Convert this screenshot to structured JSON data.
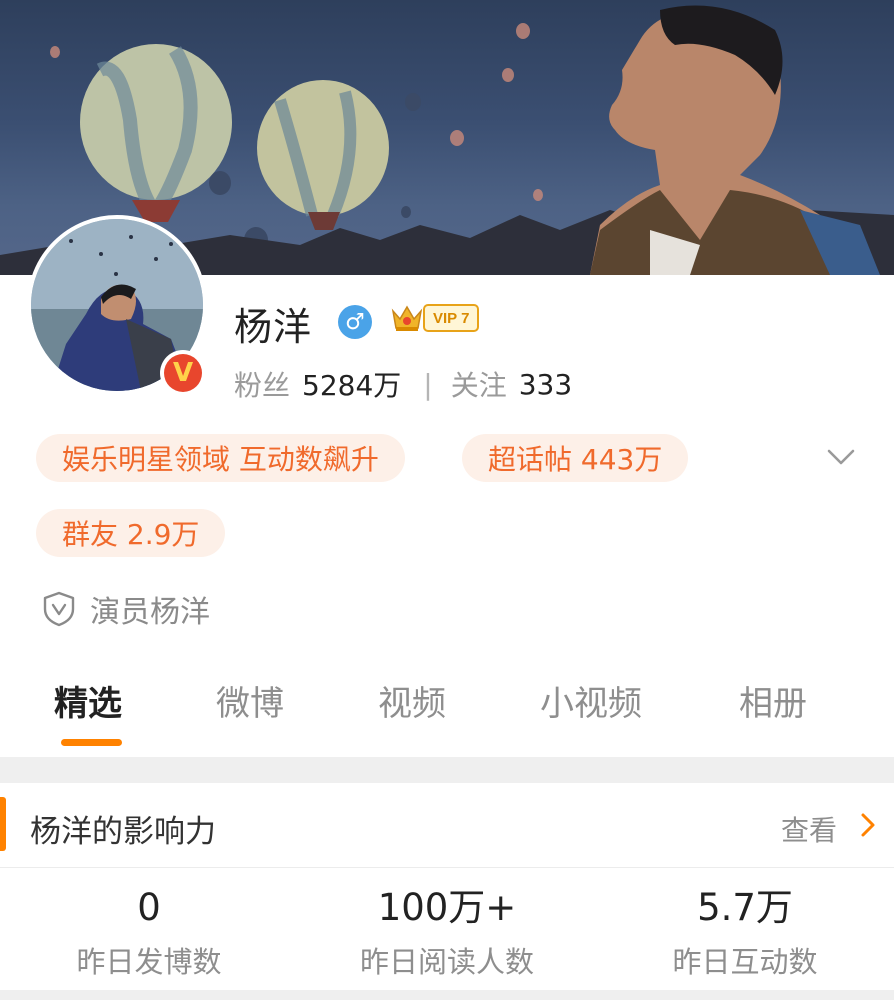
{
  "profile": {
    "name": "杨洋",
    "gender_icon": "male-icon",
    "gender_symbol": "♂",
    "vip_label": "VIP 7",
    "verified_badge": "V",
    "followers_label": "粉丝",
    "followers_value": "5284万",
    "separator": "|",
    "following_label": "关注",
    "following_value": "333"
  },
  "tags": [
    {
      "label": "娱乐明星领域 互动数飙升"
    },
    {
      "label": "超话帖 443万"
    },
    {
      "label": "群友 2.9万"
    }
  ],
  "description": "演员杨洋",
  "tabs": [
    {
      "label": "精选",
      "active": true
    },
    {
      "label": "微博",
      "active": false
    },
    {
      "label": "视频",
      "active": false
    },
    {
      "label": "小视频",
      "active": false
    },
    {
      "label": "相册",
      "active": false
    }
  ],
  "influence": {
    "title": "杨洋的影响力",
    "more_label": "查看",
    "metrics": [
      {
        "value": "0",
        "label": "昨日发博数"
      },
      {
        "value": "100万+",
        "label": "昨日阅读人数"
      },
      {
        "value": "5.7万",
        "label": "昨日互动数"
      }
    ]
  },
  "colors": {
    "accent": "#ff8200",
    "tag_text": "#f06a2c",
    "tag_bg": "#fdf0e8",
    "gender_bg": "#4aa3e8",
    "verified_bg": "#e8462d"
  }
}
